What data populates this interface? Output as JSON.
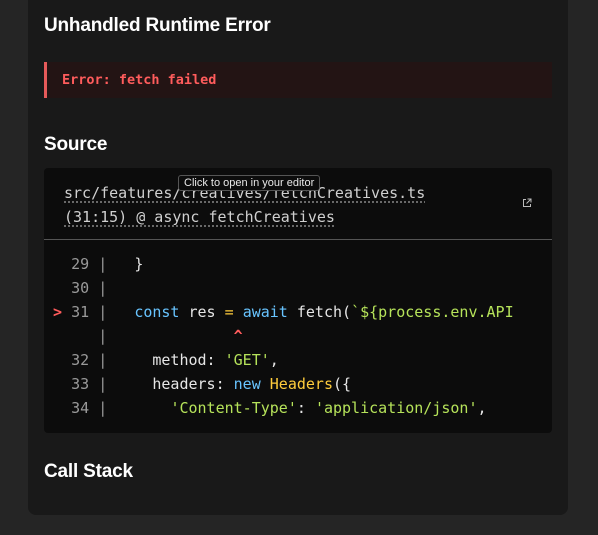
{
  "dialog": {
    "title": "Unhandled Runtime Error",
    "error_message": "Error: fetch failed",
    "source_heading": "Source",
    "call_stack_heading": "Call Stack"
  },
  "source": {
    "file_link_line1": "src/features/creatives/fetchCreatives.ts",
    "file_link_line2": "(31:15) @ async fetchCreatives",
    "tooltip": "Click to open in your editor",
    "open_icon": "external-link-icon",
    "code": {
      "l29_num": "29",
      "l30_num": "30",
      "l31_num": "31",
      "l32_num": "32",
      "l33_num": "33",
      "l34_num": "34",
      "error_marker": ">",
      "gutter_sep": "|",
      "caret": "^",
      "l29_code": "}",
      "l31_const": "const",
      "l31_res": " res ",
      "l31_eq": "=",
      "l31_await": "await",
      "l31_fetch": " fetch(",
      "l31_tpl": "`${process.env.API",
      "l32_key": "method: ",
      "l32_val": "'GET'",
      "l32_end": ",",
      "l33_key": "headers: ",
      "l33_new": "new",
      "l33_cls": "Headers",
      "l33_end": "({",
      "l34_key": "'Content-Type'",
      "l34_colon": ": ",
      "l34_val": "'application/json'",
      "l34_end": ","
    }
  },
  "colors": {
    "error": "#ff5c5c",
    "keyword": "#68c4ff",
    "function": "#ffcd3c",
    "string": "#b6e35a"
  }
}
